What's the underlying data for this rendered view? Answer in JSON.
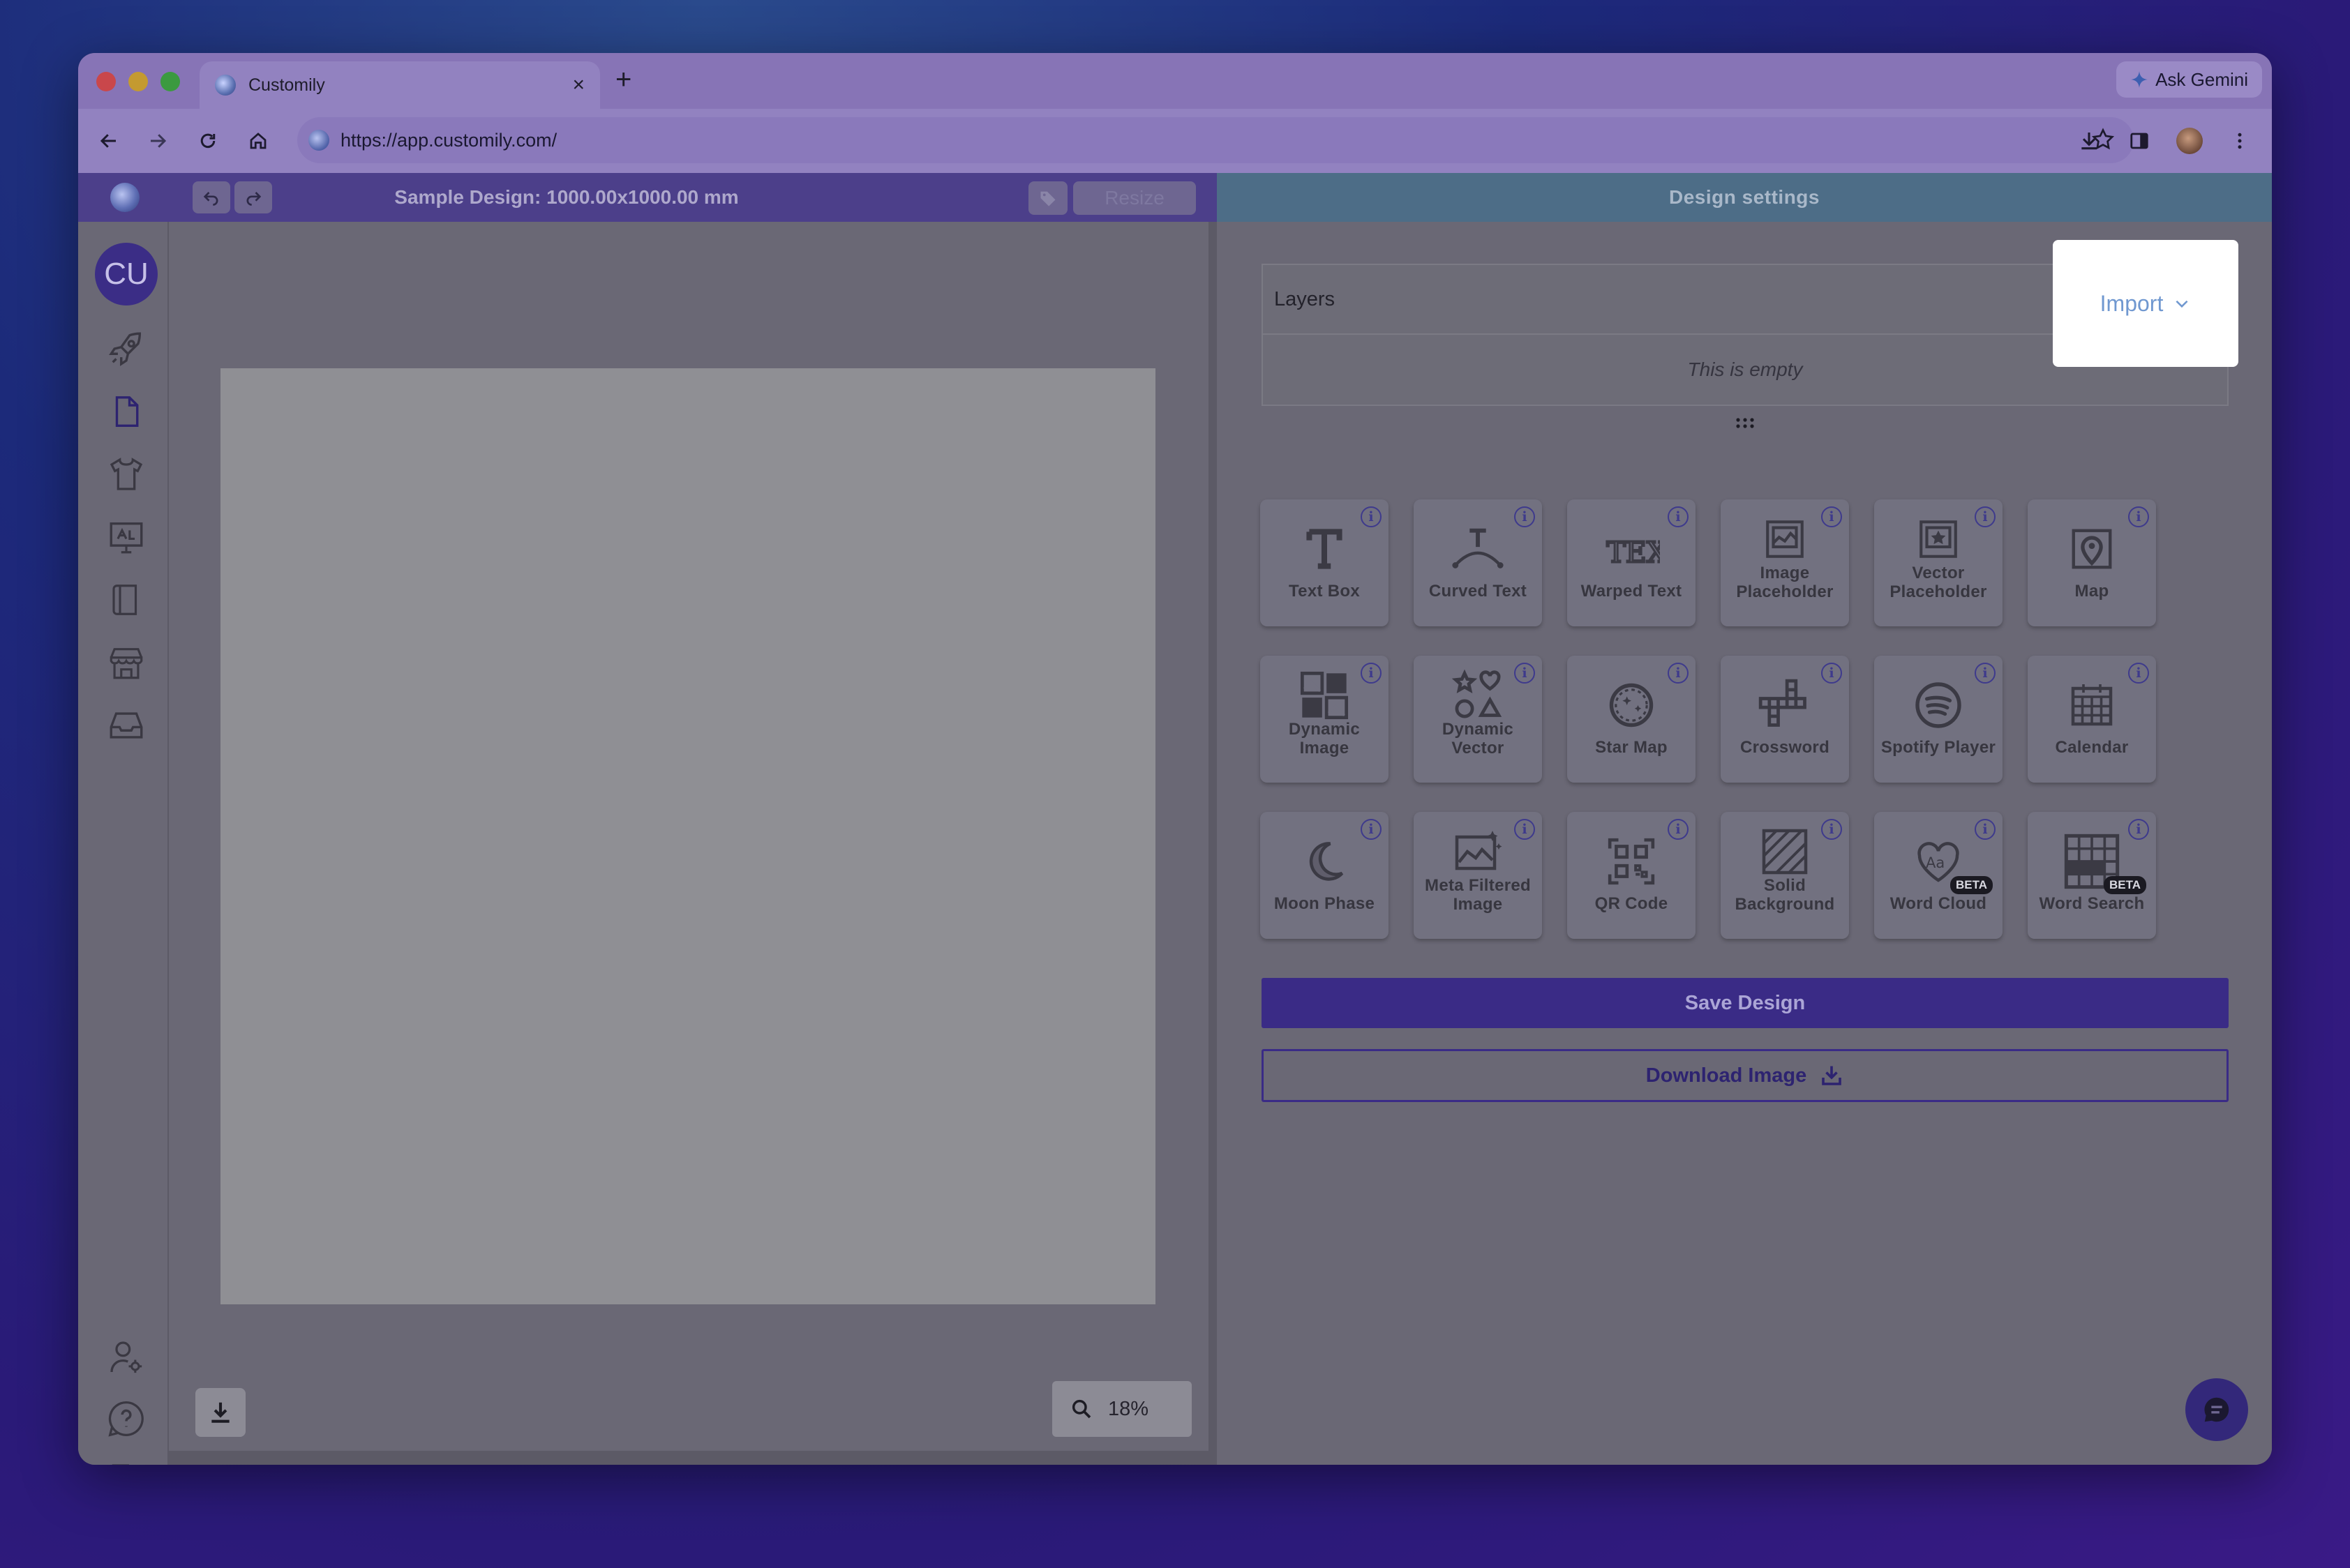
{
  "browser": {
    "tab_title": "Customily",
    "tab_close": "×",
    "new_tab": "+",
    "gemini_label": "Ask Gemini",
    "url": "https://app.customily.com/"
  },
  "app_header": {
    "design_title": "Sample Design: 1000.00x1000.00 mm",
    "resize_label": "Resize",
    "settings_title": "Design settings"
  },
  "sidebar": {
    "avatar_initials": "CU",
    "icons": [
      "rocket-icon",
      "file-icon",
      "tshirt-icon",
      "monitor-icon",
      "book-icon",
      "store-icon",
      "inbox-icon",
      "user-settings-icon",
      "help-icon",
      "logout-icon"
    ]
  },
  "canvas": {
    "zoom_label": "18%"
  },
  "layers": {
    "title": "Layers",
    "empty_text": "This is empty",
    "import_label": "Import"
  },
  "elements": [
    {
      "label": "Text Box",
      "icon": "text-box-icon",
      "beta": ""
    },
    {
      "label": "Curved Text",
      "icon": "curved-text-icon",
      "beta": ""
    },
    {
      "label": "Warped Text",
      "icon": "warped-text-icon",
      "beta": ""
    },
    {
      "label": "Image\nPlaceholder",
      "icon": "image-placeholder-icon",
      "beta": ""
    },
    {
      "label": "Vector\nPlaceholder",
      "icon": "vector-placeholder-icon",
      "beta": ""
    },
    {
      "label": "Map",
      "icon": "map-pin-icon",
      "beta": ""
    },
    {
      "label": "Dynamic\nImage",
      "icon": "dynamic-image-icon",
      "beta": ""
    },
    {
      "label": "Dynamic\nVector",
      "icon": "dynamic-vector-icon",
      "beta": ""
    },
    {
      "label": "Star Map",
      "icon": "star-map-icon",
      "beta": ""
    },
    {
      "label": "Crossword",
      "icon": "crossword-icon",
      "beta": ""
    },
    {
      "label": "Spotify Player",
      "icon": "spotify-icon",
      "beta": ""
    },
    {
      "label": "Calendar",
      "icon": "calendar-icon",
      "beta": ""
    },
    {
      "label": "Moon Phase",
      "icon": "moon-icon",
      "beta": ""
    },
    {
      "label": "Meta Filtered\nImage",
      "icon": "meta-image-icon",
      "beta": ""
    },
    {
      "label": "QR Code",
      "icon": "qr-code-icon",
      "beta": ""
    },
    {
      "label": "Solid\nBackground",
      "icon": "solid-background-icon",
      "beta": ""
    },
    {
      "label": "Word Cloud",
      "icon": "word-cloud-icon",
      "beta": "BETA"
    },
    {
      "label": "Word Search",
      "icon": "word-search-icon",
      "beta": "BETA"
    }
  ],
  "actions": {
    "save_label": "Save Design",
    "download_label": "Download Image"
  }
}
